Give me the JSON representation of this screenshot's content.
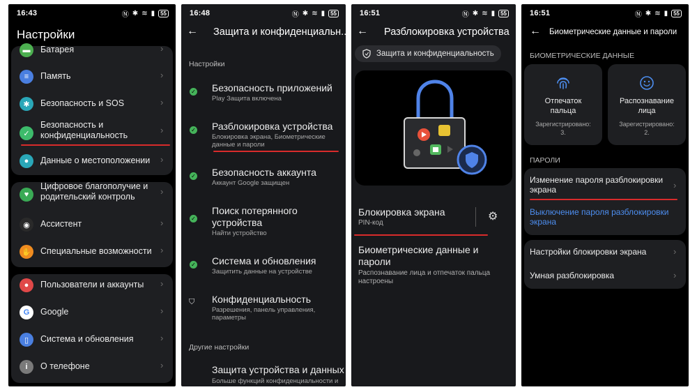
{
  "p1": {
    "time": "16:43",
    "carriers": "◀ ◷ G",
    "battery": "55",
    "title": "Настройки",
    "items": [
      {
        "label": "Батарея",
        "icon": "battery-icon",
        "color": "#4caf50"
      },
      {
        "label": "Память",
        "icon": "storage-icon",
        "color": "#4a7fe0"
      },
      {
        "label": "Безопасность и SOS",
        "icon": "sos-icon",
        "color": "#2aa7b8"
      },
      {
        "label": "Безопасность и\nконфиденциальность",
        "icon": "shield-icon",
        "color": "#3dbb6b"
      },
      {
        "label": "Данные о местоположении",
        "icon": "location-icon",
        "color": "#2aa7b8"
      },
      {
        "label": "Цифровое благополучие и\nродительский контроль",
        "icon": "heart-icon",
        "color": "#3aaa55"
      },
      {
        "label": "Ассистент",
        "icon": "assistant-icon",
        "color": "#2a2a2a"
      },
      {
        "label": "Специальные возможности",
        "icon": "hand-icon",
        "color": "#f08c20"
      },
      {
        "label": "Пользователи и аккаунты",
        "icon": "user-icon",
        "color": "#e04848"
      },
      {
        "label": "Google",
        "icon": "google-icon",
        "color": "#ffffff"
      },
      {
        "label": "Система и обновления",
        "icon": "phone-icon",
        "color": "#4a7fe0"
      },
      {
        "label": "О телефоне",
        "icon": "info-icon",
        "color": "#7a7a7a"
      }
    ]
  },
  "p2": {
    "time": "16:48",
    "carriers": "◀ ◷ G",
    "battery": "55",
    "title": "Защита и конфиденциальн...",
    "section1": "Настройки",
    "items": [
      {
        "title": "Безопасность приложений",
        "sub": "Play Защита включена"
      },
      {
        "title": "Разблокировка устройства",
        "sub": "Блокировка экрана, Биометрические\nданные и пароли"
      },
      {
        "title": "Безопасность аккаунта",
        "sub": "Аккаунт Google защищен"
      },
      {
        "title": "Поиск потерянного\nустройства",
        "sub": "Найти устройство"
      },
      {
        "title": "Система и обновления",
        "sub": "Защитить данные на устройстве"
      },
      {
        "title": "Конфиденциальность",
        "sub": "Разрешения, панель управления,\nпараметры"
      }
    ],
    "section2": "Другие настройки",
    "bottom_title": "Защита устройства и данных",
    "bottom_sub": "Больше функций конфиденциальности и"
  },
  "p3": {
    "time": "16:51",
    "carriers": "◀ ◷ G",
    "battery": "55",
    "title": "Разблокировка устройства",
    "chip": "Защита и конфиденциальность",
    "lock_title": "Блокировка экрана",
    "lock_sub": "PIN-код",
    "bio_title": "Биометрические данные и\nпароли",
    "bio_sub": "Распознавание лица и отпечаток пальца\nнастроены"
  },
  "p4": {
    "time": "16:51",
    "carriers": "◀ ◙ ◷ G",
    "battery": "55",
    "title": "Биометрические данные и пароли",
    "section1": "БИОМЕТРИЧЕСКИЕ ДАННЫЕ",
    "finger_title": "Отпечаток\nпальца",
    "finger_sub": "Зарегистрировано:\n3.",
    "face_title": "Распознавание\nлица",
    "face_sub": "Зарегистрировано:\n2.",
    "section2": "ПАРОЛИ",
    "change_pwd": "Изменение пароля разблокировки\nэкрана",
    "disable_pwd": "Выключение пароля разблокировки\nэкрана",
    "lock_settings": "Настройки блокировки экрана",
    "smart_unlock": "Умная разблокировка",
    "accent": "#4d8ef0"
  }
}
